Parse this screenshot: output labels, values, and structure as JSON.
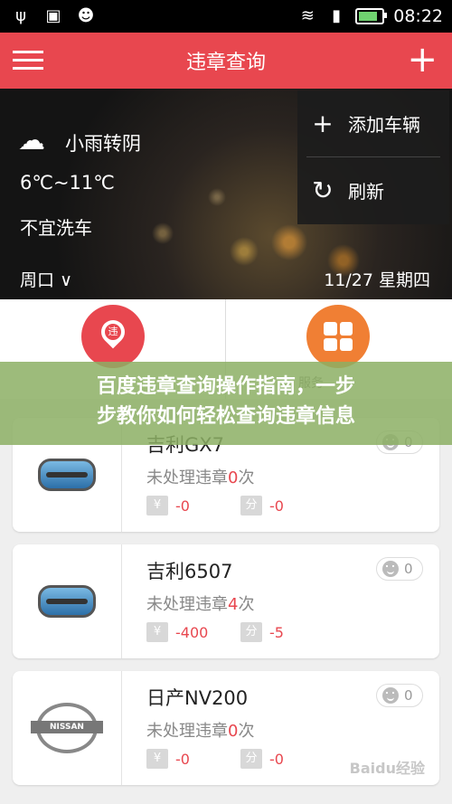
{
  "status_bar": {
    "time": "08:22",
    "left_icons": [
      "usb-icon",
      "image-icon",
      "android-icon"
    ],
    "right_icons": [
      "wifi-icon",
      "signal-icon",
      "battery-icon"
    ]
  },
  "app_bar": {
    "title": "违章查询",
    "menu_icon": "hamburger-icon",
    "add_icon": "plus-icon"
  },
  "weather": {
    "condition": "小雨转阴",
    "temp": "6℃~11℃",
    "advice": "不宜洗车",
    "week": "周口",
    "date": "11/27 星期四"
  },
  "popup_menu": {
    "items": [
      {
        "icon": "plus-icon",
        "label": "添加车辆"
      },
      {
        "icon": "refresh-icon",
        "label": "刷新"
      }
    ]
  },
  "quick_actions": {
    "left_icon": "violation-pin-icon",
    "right_icon": "services-grid-icon",
    "right_label": "服务"
  },
  "banner": {
    "line1": "百度违章查询操作指南，一步",
    "line2": "步教你如何轻松查询违章信息"
  },
  "vehicles": [
    {
      "name": "吉利GX7",
      "pending_prefix": "未处理违章",
      "pending_count": "0",
      "pending_suffix": "次",
      "fine_badge": "¥",
      "fine": "-0",
      "points_badge": "分",
      "points": "-0",
      "likes": "0",
      "brand": "geely"
    },
    {
      "name": "吉利6507",
      "pending_prefix": "未处理违章",
      "pending_count": "4",
      "pending_suffix": "次",
      "fine_badge": "¥",
      "fine": "-400",
      "points_badge": "分",
      "points": "-5",
      "likes": "0",
      "brand": "geely"
    },
    {
      "name": "日产NV200",
      "pending_prefix": "未处理违章",
      "pending_count": "0",
      "pending_suffix": "次",
      "fine_badge": "¥",
      "fine": "-0",
      "points_badge": "分",
      "points": "-0",
      "likes": "0",
      "brand": "nissan"
    }
  ],
  "nissan_logo_text": "NISSAN",
  "watermark": "Baidu经验",
  "colors": {
    "accent": "#e8474f",
    "orange": "#f07f34"
  }
}
